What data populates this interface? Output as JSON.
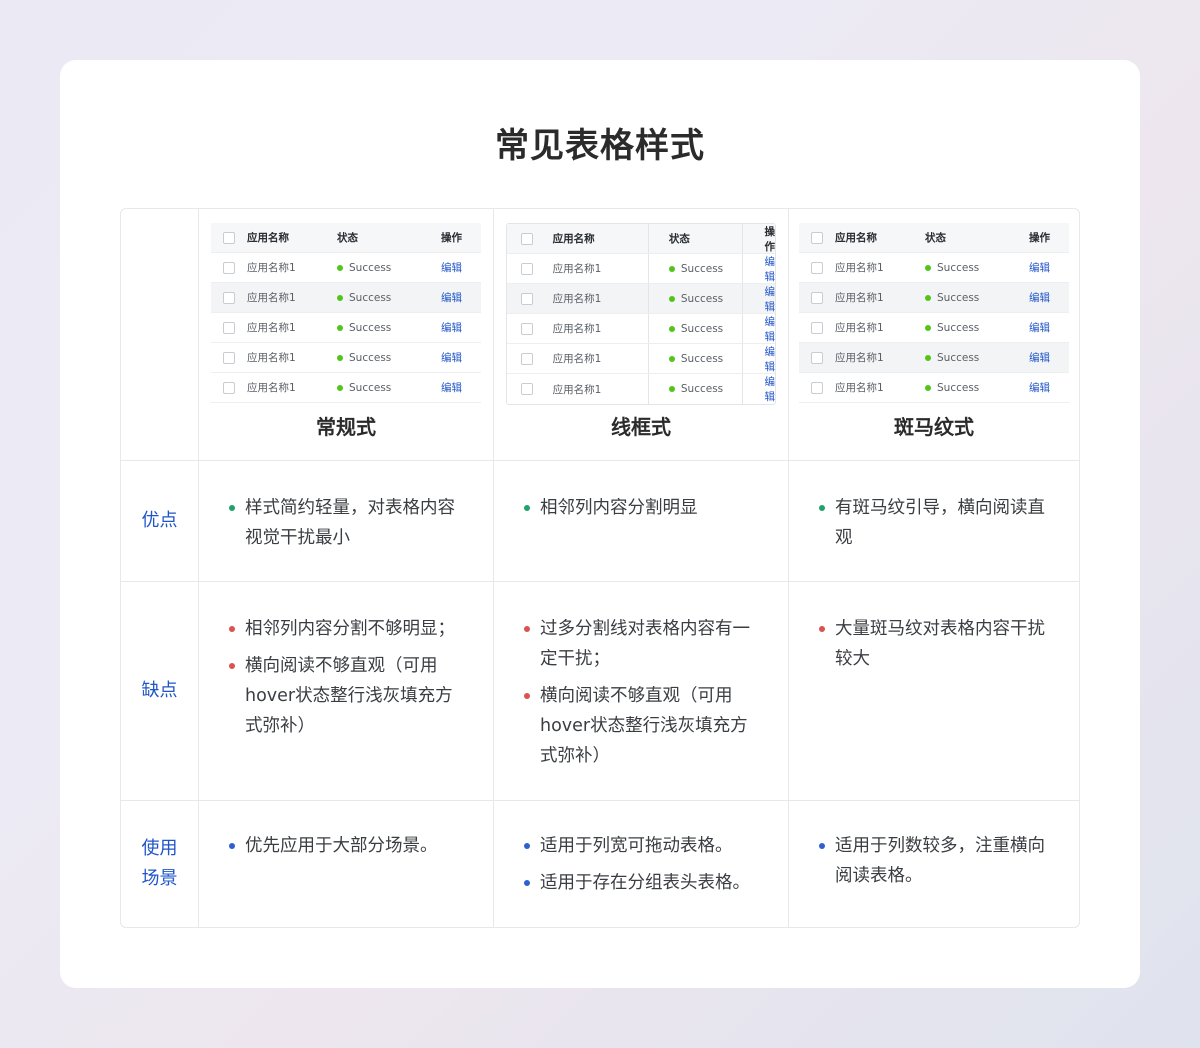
{
  "page": {
    "title": "常见表格样式"
  },
  "mini_table": {
    "headers": [
      "应用名称",
      "状态",
      "操作"
    ],
    "row": {
      "name": "应用名称1",
      "status": "Success",
      "action": "编辑"
    }
  },
  "styles": [
    {
      "name": "常规式"
    },
    {
      "name": "线框式"
    },
    {
      "name": "斑马纹式"
    }
  ],
  "rows": {
    "pros": {
      "label": "优点"
    },
    "cons": {
      "label": "缺点"
    },
    "usage": {
      "label_line1": "使用",
      "label_line2": "场景"
    }
  },
  "content": {
    "regular": {
      "pros": [
        "样式简约轻量，对表格内容视觉干扰最小"
      ],
      "cons": [
        "相邻列内容分割不够明显；",
        "横向阅读不够直观（可用hover状态整行浅灰填充方式弥补）"
      ],
      "usage": [
        "优先应用于大部分场景。"
      ]
    },
    "bordered": {
      "pros": [
        "相邻列内容分割明显"
      ],
      "cons": [
        "过多分割线对表格内容有一定干扰；",
        "横向阅读不够直观（可用hover状态整行浅灰填充方式弥补）"
      ],
      "usage": [
        "适用于列宽可拖动表格。",
        "适用于存在分组表头表格。"
      ]
    },
    "zebra": {
      "pros": [
        "有斑马纹引导，横向阅读直观"
      ],
      "cons": [
        "大量斑马纹对表格内容干扰较大"
      ],
      "usage": [
        "适用于列数较多，注重横向阅读表格。"
      ]
    }
  },
  "colors": {
    "accent_blue": "#1f55c9",
    "success_green": "#52c41a",
    "pros_bullet": "#1fa36a",
    "cons_bullet": "#d9534f",
    "usage_bullet": "#2f5fd0"
  }
}
